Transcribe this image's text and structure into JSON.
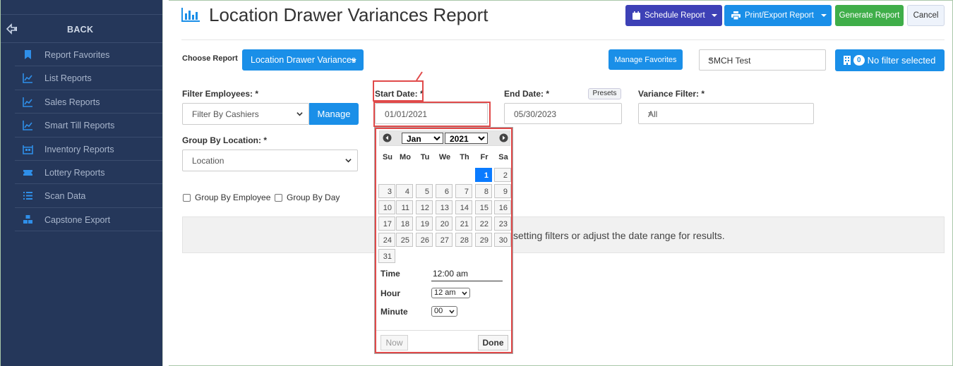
{
  "sidebar": {
    "back_label": "BACK",
    "items": [
      {
        "label": "Report Favorites",
        "icon": "bookmark-icon"
      },
      {
        "label": "List Reports",
        "icon": "line-chart-icon"
      },
      {
        "label": "Sales Reports",
        "icon": "line-chart-icon"
      },
      {
        "label": "Smart Till Reports",
        "icon": "line-chart-icon"
      },
      {
        "label": "Inventory Reports",
        "icon": "warehouse-icon"
      },
      {
        "label": "Lottery Reports",
        "icon": "ticket-icon"
      },
      {
        "label": "Scan Data",
        "icon": "list-icon"
      },
      {
        "label": "Capstone Export",
        "icon": "boxes-icon"
      }
    ]
  },
  "header": {
    "title": "Location Drawer Variances Report",
    "schedule_label": "Schedule Report",
    "print_label": "Print/Export Report",
    "generate_label": "Generate Report",
    "cancel_label": "Cancel"
  },
  "toolbar": {
    "choose_report_label": "Choose Report",
    "report_select": "Location Drawer Variances",
    "manage_favorites_label": "Manage Favorites",
    "store_select": "SMCH Test",
    "filter_count": "0",
    "filter_label": "No filter selected"
  },
  "filters": {
    "employees_label": "Filter Employees: *",
    "employees_value": "Filter By Cashiers",
    "manage_label": "Manage",
    "start_label": "Start Date: *",
    "start_value": "01/01/2021",
    "end_label": "End Date: *",
    "presets_label": "Presets",
    "end_value": "05/30/2023",
    "variance_label": "Variance Filter: *",
    "variance_value": "All",
    "group_location_label": "Group By Location: *",
    "group_location_value": "Location",
    "group_employee_label": "Group By Employee",
    "group_day_label": "Group By Day"
  },
  "message": "setting filters or adjust the date range for results.",
  "datepicker": {
    "month": "Jan",
    "year": "2021",
    "weekdays": [
      "Su",
      "Mo",
      "Tu",
      "We",
      "Th",
      "Fr",
      "Sa"
    ],
    "days": [
      "1",
      "2",
      "3",
      "4",
      "5",
      "6",
      "7",
      "8",
      "9",
      "10",
      "11",
      "12",
      "13",
      "14",
      "15",
      "16",
      "17",
      "18",
      "19",
      "20",
      "21",
      "22",
      "23",
      "24",
      "25",
      "26",
      "27",
      "28",
      "29",
      "30",
      "31"
    ],
    "selected_day": "1",
    "time_label": "Time",
    "time_value": "12:00 am",
    "hour_label": "Hour",
    "hour_value": "12 am",
    "minute_label": "Minute",
    "minute_value": "00",
    "now_label": "Now",
    "done_label": "Done"
  },
  "colors": {
    "sidebar_bg": "#25375a",
    "primary": "#1a8fe8",
    "indigo": "#3d41b6",
    "green": "#3fae49",
    "highlight": "#e04a4a"
  }
}
